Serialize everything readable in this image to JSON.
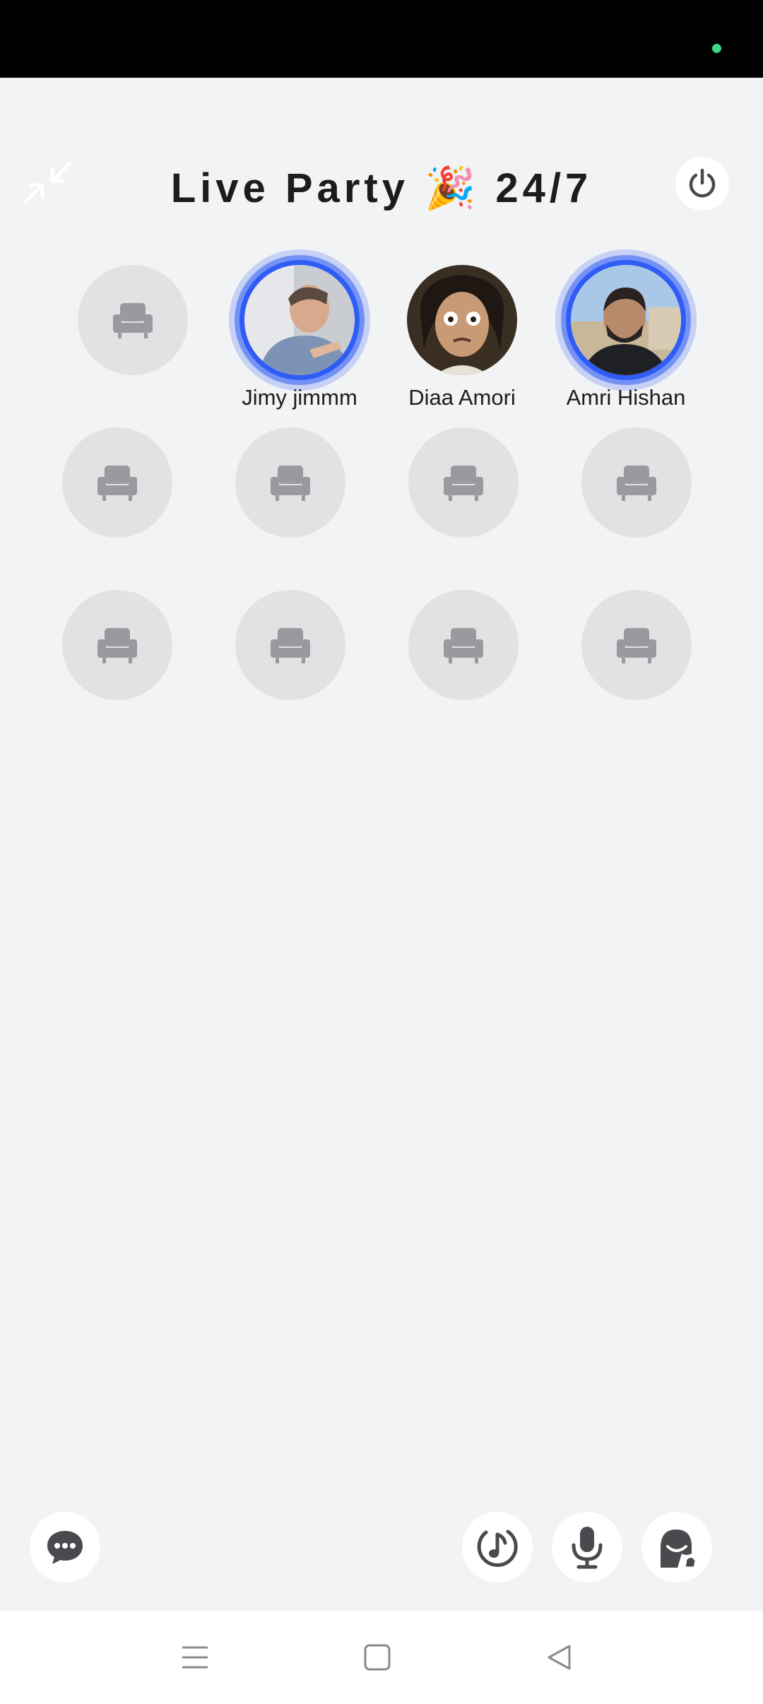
{
  "status_bar": {
    "indicator_color": "#3ddc84",
    "indicator_icon": "status-dot"
  },
  "header": {
    "title": "Live Party 🎉 24/7",
    "minimize_icon": "minimize-arrows-icon",
    "power_icon": "power-icon"
  },
  "colors": {
    "background": "#f2f3f5",
    "seat_empty": "#e2e2e4",
    "seat_icon": "#9a9a9e",
    "speaking_ring": "#2f5cf5",
    "text": "#1c1c1e"
  },
  "seats": [
    {
      "occupied": false,
      "icon": "armchair-icon"
    },
    {
      "occupied": true,
      "name": "Jimy jimmm",
      "speaking": true
    },
    {
      "occupied": true,
      "name": "Diaa Amori",
      "speaking": false
    },
    {
      "occupied": true,
      "name": "Amri Hishan",
      "speaking": true
    },
    {
      "occupied": false,
      "icon": "armchair-icon"
    },
    {
      "occupied": false,
      "icon": "armchair-icon"
    },
    {
      "occupied": false,
      "icon": "armchair-icon"
    },
    {
      "occupied": false,
      "icon": "armchair-icon"
    },
    {
      "occupied": false,
      "icon": "armchair-icon"
    },
    {
      "occupied": false,
      "icon": "armchair-icon"
    },
    {
      "occupied": false,
      "icon": "armchair-icon"
    },
    {
      "occupied": false,
      "icon": "armchair-icon"
    }
  ],
  "bottom_bar": {
    "chat_icon": "chat-bubble-icon",
    "music_icon": "music-note-icon",
    "mic_icon": "microphone-icon",
    "raise_hand_icon": "raise-hand-icon"
  },
  "nav_bar": {
    "menu_icon": "menu-icon",
    "home_icon": "home-square-icon",
    "back_icon": "back-triangle-icon"
  }
}
